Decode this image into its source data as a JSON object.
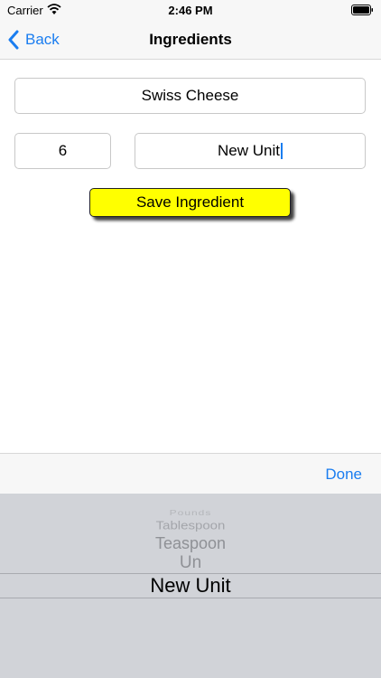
{
  "status": {
    "carrier": "Carrier",
    "time": "2:46 PM"
  },
  "nav": {
    "back_label": "Back",
    "title": "Ingredients"
  },
  "form": {
    "name_value": "Swiss Cheese",
    "quantity_value": "6",
    "unit_value": "New Unit"
  },
  "save_label": "Save Ingredient",
  "toolbar": {
    "done_label": "Done"
  },
  "picker": {
    "options": [
      "Pounds",
      "Tablespoon",
      "Teaspoon",
      "Un",
      "New Unit"
    ],
    "selected": "New Unit"
  },
  "colors": {
    "accent": "#1a7df0",
    "button_bg": "#ffff00",
    "picker_bg": "#d1d3d8"
  }
}
